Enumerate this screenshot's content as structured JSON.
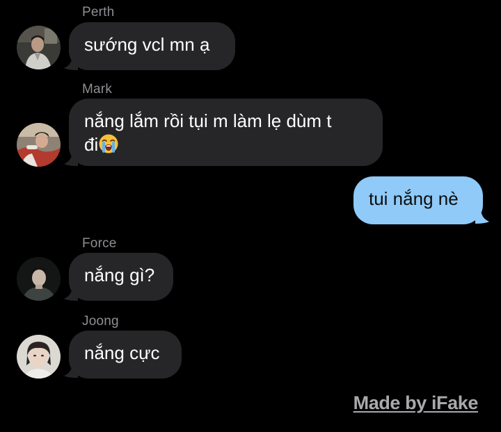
{
  "messages": [
    {
      "sender": "Perth",
      "text": "sướng vcl mn ạ",
      "direction": "incoming",
      "avatar": "avatar-perth"
    },
    {
      "sender": "Mark",
      "line1": "nắng lắm rồi tụi m làm lẹ dùm t",
      "line2": "đi",
      "emoji": "loudly-crying-face-icon",
      "direction": "incoming",
      "avatar": "avatar-mark"
    },
    {
      "text": "tui nắng nè",
      "direction": "outgoing"
    },
    {
      "sender": "Force",
      "text": "nắng gì?",
      "direction": "incoming",
      "avatar": "avatar-force"
    },
    {
      "sender": "Joong",
      "text": "nắng cực",
      "direction": "incoming",
      "avatar": "avatar-joong"
    }
  ],
  "watermark": "Made by iFake",
  "colors": {
    "background": "#000000",
    "incoming_bubble": "#262628",
    "outgoing_bubble": "#8fcaf9",
    "sender_name": "#8e8e93",
    "watermark": "#a9a9ad"
  }
}
